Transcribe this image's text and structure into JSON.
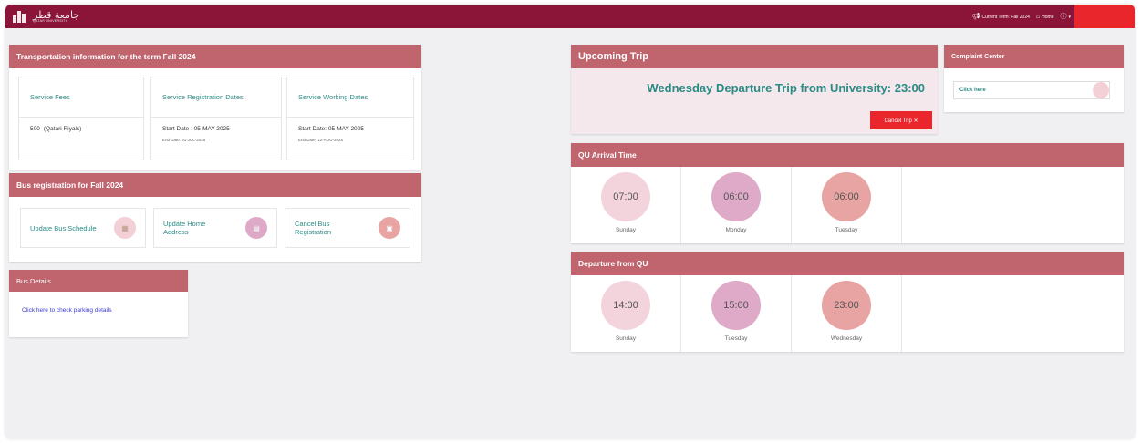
{
  "header": {
    "logo_arabic": "جامعة قطر",
    "logo_english": "QATAR UNIVERSITY",
    "current_term": "Current Term: Fall 2024",
    "home": "Home",
    "help_icon": "help-icon",
    "colors": {
      "bar": "#8a1538",
      "red": "#e8262b"
    }
  },
  "transport": {
    "title": "Transportation information for the term Fall 2024",
    "cards": [
      {
        "heading": "Service Fees",
        "value": "500- (Qatari Riyals)",
        "sub": ""
      },
      {
        "heading": "Service Registration Dates",
        "value": "Start Date : 05-MAY-2025",
        "sub": "End Date: 31-JUL-2025"
      },
      {
        "heading": "Service Working Dates",
        "value": "Start Date: 05-MAY-2025",
        "sub": "End Date: 12-AUG-2025"
      }
    ]
  },
  "bus_registration": {
    "title": "Bus registration for Fall 2024",
    "actions": [
      {
        "label": "Update Bus Schedule",
        "icon": "calendar-icon",
        "color": "#f3cfd6"
      },
      {
        "label": "Update Home Address",
        "icon": "home-doc-icon",
        "color": "#dea9c6"
      },
      {
        "label": "Cancel Bus Registration",
        "icon": "cancel-doc-icon",
        "color": "#e8a3a3"
      }
    ]
  },
  "bus_details": {
    "title": "Bus Details",
    "link": "Click here to check parking details"
  },
  "upcoming_trip": {
    "title": "Upcoming Trip",
    "trip": "Wednesday Departure Trip from University: 23:00",
    "cancel": "Cancel Trip ✕"
  },
  "complaint": {
    "title": "Complaint Center",
    "link": "Click here"
  },
  "arrival": {
    "title": "QU Arrival Time",
    "items": [
      {
        "time": "07:00",
        "day": "Sunday",
        "color": "#f3d3dc"
      },
      {
        "time": "06:00",
        "day": "Monday",
        "color": "#dfa9c8"
      },
      {
        "time": "06:00",
        "day": "Tuesday",
        "color": "#e8a3a3"
      }
    ]
  },
  "departure": {
    "title": "Departure from QU",
    "items": [
      {
        "time": "14:00",
        "day": "Sunday",
        "color": "#f3d3dc"
      },
      {
        "time": "15:00",
        "day": "Tuesday",
        "color": "#dfa9c8"
      },
      {
        "time": "23:00",
        "day": "Wednesday",
        "color": "#e8a3a3"
      }
    ]
  }
}
